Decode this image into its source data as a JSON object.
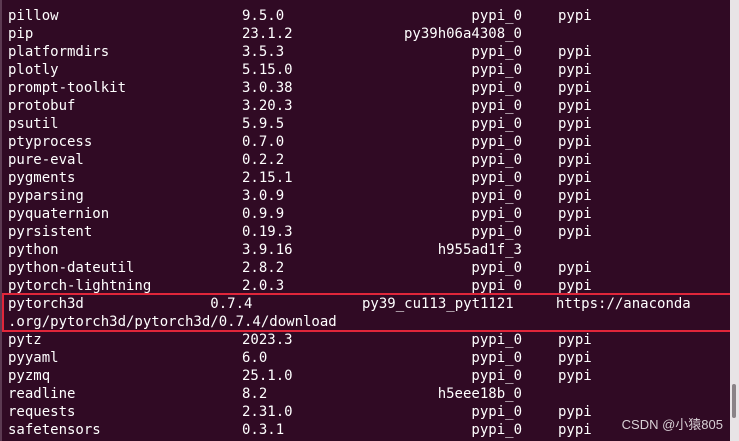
{
  "packages": [
    {
      "name": "pillow",
      "version": "9.5.0",
      "build": "pypi_0",
      "channel": "pypi"
    },
    {
      "name": "pip",
      "version": "23.1.2",
      "build": "py39h06a4308_0",
      "channel": ""
    },
    {
      "name": "platformdirs",
      "version": "3.5.3",
      "build": "pypi_0",
      "channel": "pypi"
    },
    {
      "name": "plotly",
      "version": "5.15.0",
      "build": "pypi_0",
      "channel": "pypi"
    },
    {
      "name": "prompt-toolkit",
      "version": "3.0.38",
      "build": "pypi_0",
      "channel": "pypi"
    },
    {
      "name": "protobuf",
      "version": "3.20.3",
      "build": "pypi_0",
      "channel": "pypi"
    },
    {
      "name": "psutil",
      "version": "5.9.5",
      "build": "pypi_0",
      "channel": "pypi"
    },
    {
      "name": "ptyprocess",
      "version": "0.7.0",
      "build": "pypi_0",
      "channel": "pypi"
    },
    {
      "name": "pure-eval",
      "version": "0.2.2",
      "build": "pypi_0",
      "channel": "pypi"
    },
    {
      "name": "pygments",
      "version": "2.15.1",
      "build": "pypi_0",
      "channel": "pypi"
    },
    {
      "name": "pyparsing",
      "version": "3.0.9",
      "build": "pypi_0",
      "channel": "pypi"
    },
    {
      "name": "pyquaternion",
      "version": "0.9.9",
      "build": "pypi_0",
      "channel": "pypi"
    },
    {
      "name": "pyrsistent",
      "version": "0.19.3",
      "build": "pypi_0",
      "channel": "pypi"
    },
    {
      "name": "python",
      "version": "3.9.16",
      "build": "h955ad1f_3",
      "channel": ""
    },
    {
      "name": "python-dateutil",
      "version": "2.8.2",
      "build": "pypi_0",
      "channel": "pypi"
    },
    {
      "name": "pytorch-lightning",
      "version": "2.0.3",
      "build": "pypi_0",
      "channel": "pypi"
    },
    {
      "name": "pytz",
      "version": "2023.3",
      "build": "pypi_0",
      "channel": "pypi"
    },
    {
      "name": "pyyaml",
      "version": "6.0",
      "build": "pypi_0",
      "channel": "pypi"
    },
    {
      "name": "pyzmq",
      "version": "25.1.0",
      "build": "pypi_0",
      "channel": "pypi"
    },
    {
      "name": "readline",
      "version": "8.2",
      "build": "h5eee18b_0",
      "channel": ""
    },
    {
      "name": "requests",
      "version": "2.31.0",
      "build": "pypi_0",
      "channel": "pypi"
    },
    {
      "name": "safetensors",
      "version": "0.3.1",
      "build": "pypi_0",
      "channel": "pypi"
    }
  ],
  "highlighted": {
    "line1": "pytorch3d               0.7.4             py39_cu113_pyt1121     https://anaconda",
    "line2": ".org/pytorch3d/pytorch3d/0.7.4/download"
  },
  "watermark": "CSDN @小猿805",
  "colors": {
    "background": "#300a24",
    "text": "#ffffff",
    "highlight_border": "#e0263a"
  }
}
